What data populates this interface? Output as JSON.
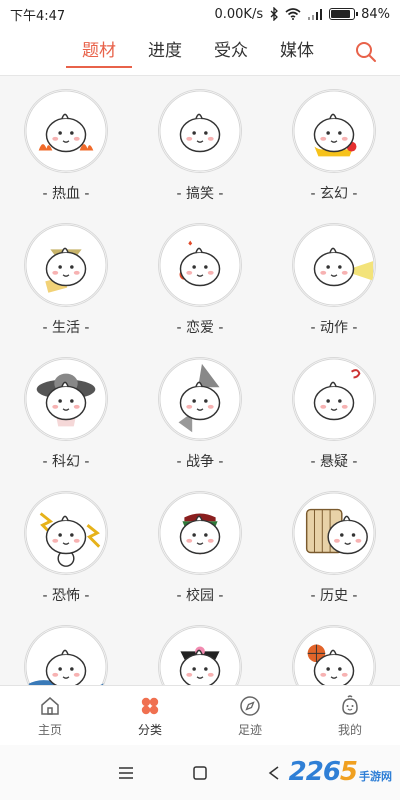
{
  "status": {
    "time": "下午4:47",
    "speed": "0.00K/s",
    "battery": "84%",
    "battery_level": 0.84
  },
  "tabs": [
    {
      "label": "题材",
      "active": true
    },
    {
      "label": "进度",
      "active": false
    },
    {
      "label": "受众",
      "active": false
    },
    {
      "label": "媒体",
      "active": false
    }
  ],
  "genres": [
    {
      "label": "- 热血 -",
      "icon": "hot-blooded-mascot-icon"
    },
    {
      "label": "- 搞笑 -",
      "icon": "comedy-mascot-icon"
    },
    {
      "label": "- 玄幻 -",
      "icon": "fantasy-mascot-icon"
    },
    {
      "label": "- 生活 -",
      "icon": "daily-life-mascot-icon"
    },
    {
      "label": "- 恋爱 -",
      "icon": "romance-mascot-icon"
    },
    {
      "label": "- 动作 -",
      "icon": "action-mascot-icon"
    },
    {
      "label": "- 科幻 -",
      "icon": "sci-fi-mascot-icon"
    },
    {
      "label": "- 战争 -",
      "icon": "war-mascot-icon"
    },
    {
      "label": "- 悬疑 -",
      "icon": "mystery-mascot-icon"
    },
    {
      "label": "- 恐怖 -",
      "icon": "horror-mascot-icon"
    },
    {
      "label": "- 校园 -",
      "icon": "campus-mascot-icon"
    },
    {
      "label": "- 历史 -",
      "icon": "history-mascot-icon"
    },
    {
      "label": "",
      "icon": "sports-mascot-icon"
    },
    {
      "label": "",
      "icon": "palace-mascot-icon"
    },
    {
      "label": "",
      "icon": "basketball-mascot-icon"
    }
  ],
  "bottom_nav": [
    {
      "label": "主页",
      "icon": "home-icon"
    },
    {
      "label": "分类",
      "icon": "category-icon",
      "active": true
    },
    {
      "label": "足迹",
      "icon": "compass-icon"
    },
    {
      "label": "我的",
      "icon": "profile-icon"
    }
  ],
  "watermark": {
    "number_a": "22",
    "number_b": "6",
    "number_c": "5",
    "text": "手游网"
  },
  "colors": {
    "accent": "#e8624a",
    "category_active": "#f07050"
  }
}
